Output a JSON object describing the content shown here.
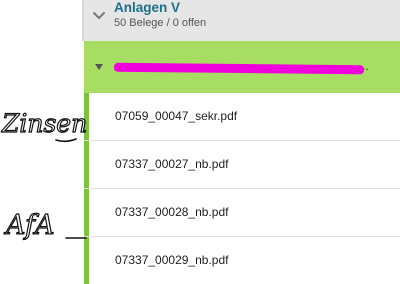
{
  "group": {
    "title": "Anlagen V",
    "subtitle": "50 Belege / 0 offen",
    "icon": "chevron-down-icon"
  },
  "subgroup": {
    "icon": "caret-down-icon",
    "label_redacted": true,
    "highlight_color": "#a8dd64",
    "redaction_color": "#f000dc"
  },
  "documents": [
    {
      "name": "07059_00047_sekr.pdf"
    },
    {
      "name": "07337_00027_nb.pdf"
    },
    {
      "name": "07337_00028_nb.pdf"
    },
    {
      "name": "07337_00029_nb.pdf"
    }
  ],
  "annotations": {
    "first": "Zinsen",
    "second": "AfA"
  },
  "colors": {
    "accent_bar": "#7cc23e",
    "group_title": "#1a6f8a",
    "header_bg": "#e6e6e6"
  }
}
